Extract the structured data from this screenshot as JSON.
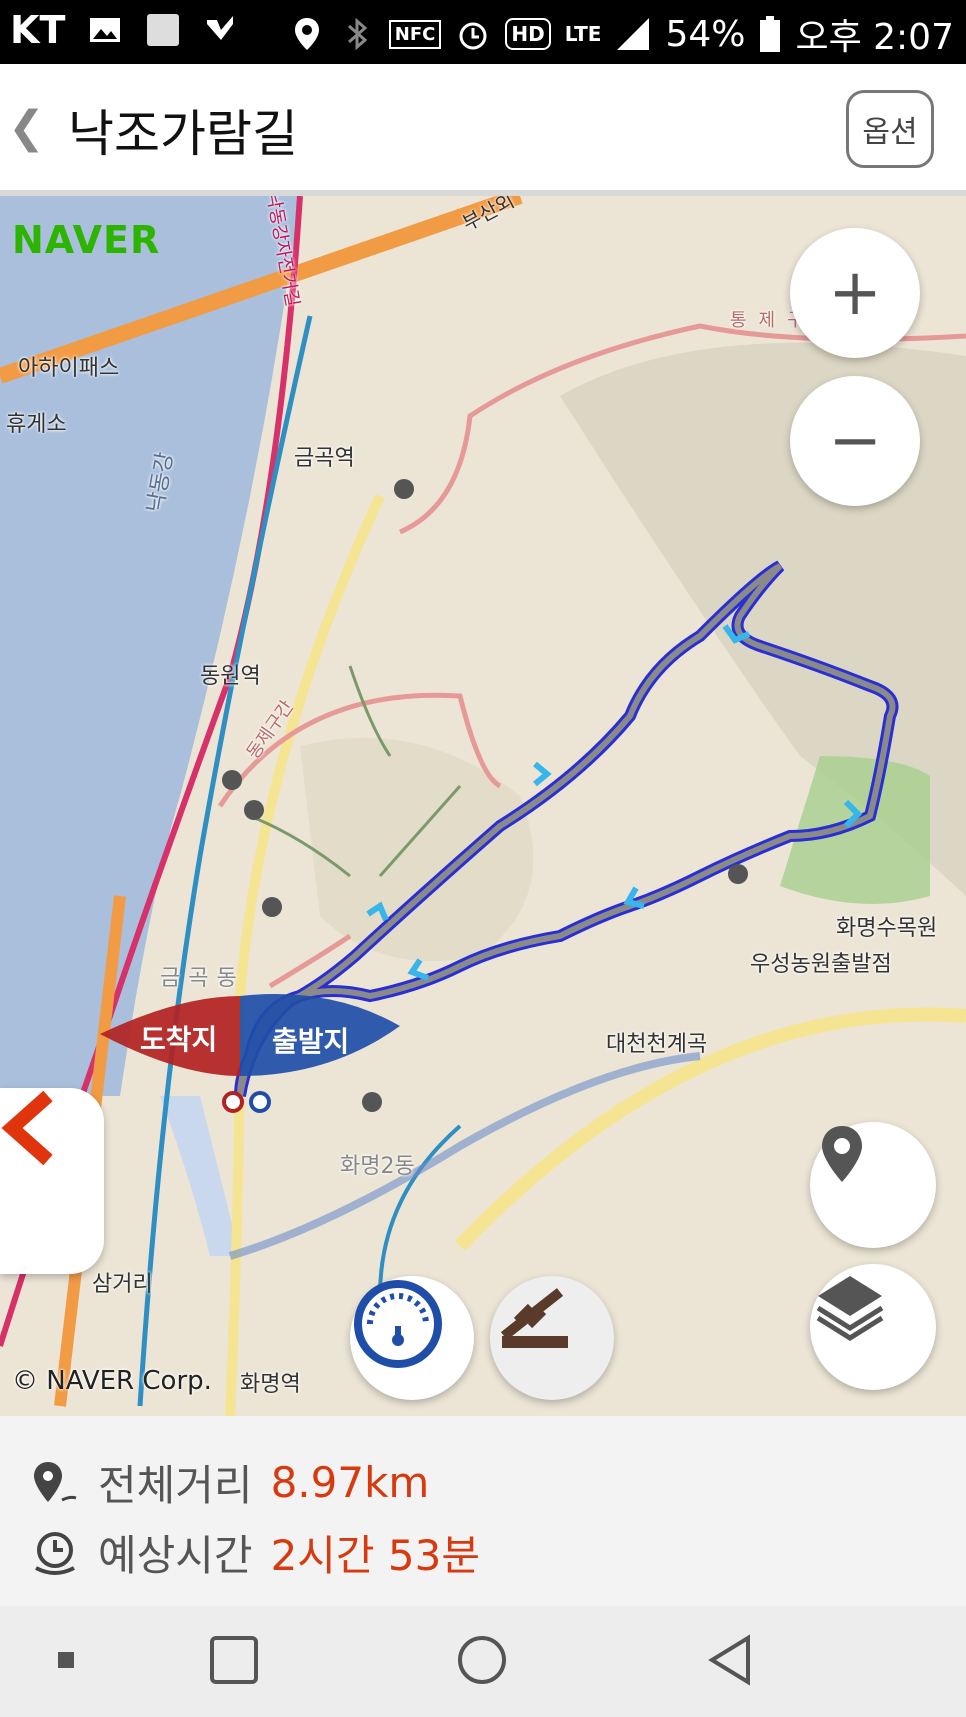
{
  "status_bar": {
    "carrier": "KT",
    "icons": [
      "image-icon",
      "square-icon",
      "check-icon",
      "location-icon",
      "bluetooth-icon",
      "nfc-icon",
      "alarm-icon",
      "hd-icon",
      "lte-icon",
      "signal-icon"
    ],
    "nfc_text": "NFC",
    "hd_text": "HD",
    "lte_text": "LTE",
    "battery": "54%",
    "time": "오후 2:07"
  },
  "app_bar": {
    "back_glyph": "❮",
    "title": "낙조가람길",
    "option_label": "옵션"
  },
  "map": {
    "logo": "NAVER",
    "copyright": "© NAVER Corp.",
    "labels": {
      "ahai_pass": "아하이패스",
      "rest_area": "휴게소",
      "river": "낙동강",
      "geumgok_station": "금곡역",
      "hwamyeong_station_north": "동원역",
      "geumgok_dong": "금곡동",
      "daecheon_valley": "대천천계곡",
      "arboretum": "화명수목원",
      "farm_entrance": "우성농원출발점",
      "hwamyeong_station": "화명역",
      "samgeori": "삼거리",
      "hwamyeong2dong": "화명2동",
      "busan_outer": "부산외",
      "bike_path": "낙동강자전거길",
      "trail_segment": "통제구간",
      "trail_segment_2": "동제구간"
    },
    "arrival_flag": "도착지",
    "departure_flag": "출발지",
    "colors": {
      "route": "#8a8a8a",
      "route_outline": "#2a2fd4",
      "arrival": "#b22222",
      "departure": "#1f4ea8",
      "river": "#a9bfdc",
      "land": "#ece5d6"
    }
  },
  "controls": {
    "zoom_in": "+",
    "zoom_out": "−",
    "side_back_icon": "chevron-left-icon",
    "location_icon": "location-pin-icon",
    "layers_icon": "layers-icon",
    "speed_icon": "speedometer-icon",
    "slope_icon": "slope-icon"
  },
  "summary": {
    "distance_label": "전체거리",
    "distance_value": "8.97km",
    "time_label": "예상시간",
    "time_value": "2시간 53분"
  },
  "nav_bar": {
    "items": [
      "recent-icon",
      "overview-icon",
      "home-icon",
      "back-icon"
    ]
  }
}
